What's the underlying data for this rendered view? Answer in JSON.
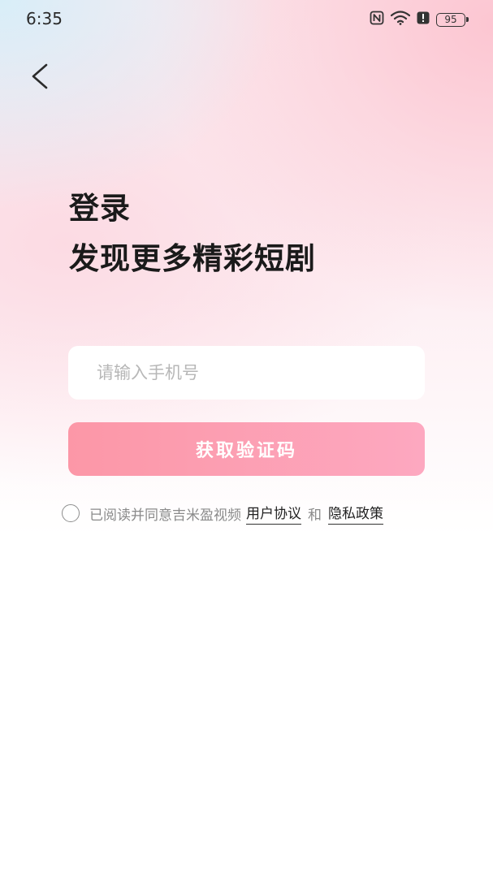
{
  "status_bar": {
    "time": "6:35",
    "icons": [
      "nfc-icon",
      "wifi-icon",
      "alert-icon"
    ],
    "battery": "95"
  },
  "nav": {
    "back_icon": "chevron-left-icon"
  },
  "header": {
    "title_line1": "登录",
    "title_line2": "发现更多精彩短剧"
  },
  "form": {
    "phone_placeholder": "请输入手机号",
    "phone_value": "",
    "get_code_label": "获取验证码"
  },
  "agreement": {
    "checked": false,
    "prefix": "已阅读并同意吉米盈视频",
    "user_agreement": "用户协议",
    "connector": "和",
    "privacy_policy": "隐私政策"
  },
  "colors": {
    "button_gradient_start": "#fc97a7",
    "button_gradient_end": "#fda8c0",
    "title": "#1a1a1a",
    "placeholder": "#b7b7b7"
  }
}
